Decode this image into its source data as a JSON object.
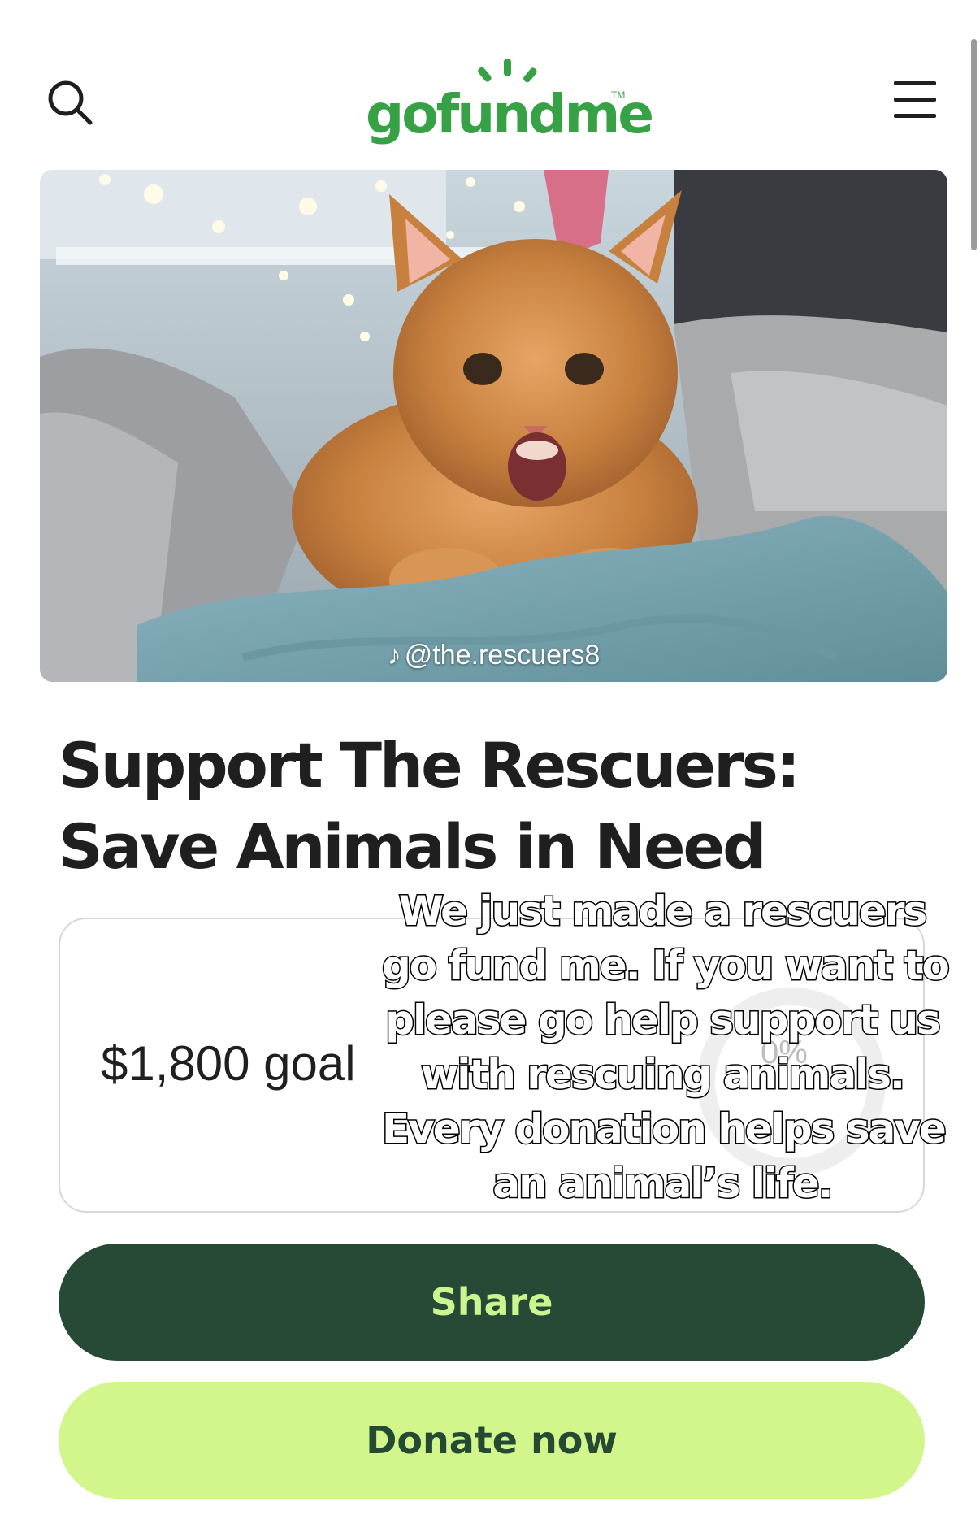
{
  "header": {
    "logo_text": "gofundme",
    "logo_tm": "TM",
    "search_icon": "search-icon",
    "menu_icon": "hamburger-menu-icon"
  },
  "hero": {
    "watermark_handle": "@the.rescuers8",
    "watermark_icon": "tiktok-icon"
  },
  "campaign": {
    "title": "Support The Rescuers: Save Animals in Need",
    "goal_text": "$1,800 goal",
    "progress_percent": "0%",
    "progress_fraction": 0
  },
  "caption_overlay": {
    "lines": [
      "We just made a rescuers",
      "go fund me. If you want to",
      "please go help support us",
      "with rescuing animals.",
      "Every donation helps save",
      "an animal’s life."
    ]
  },
  "actions": {
    "share_label": "Share",
    "donate_label": "Donate now"
  },
  "colors": {
    "brand_green": "#36a145",
    "share_bg": "#264a35",
    "share_text": "#cbf590",
    "donate_bg": "#d2f68c",
    "donate_text": "#244a33"
  }
}
